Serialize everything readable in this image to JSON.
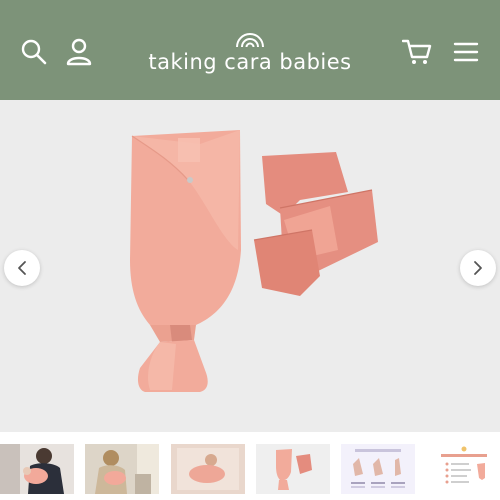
{
  "brand": {
    "name": "taking cara babies",
    "header_color": "#7d9379",
    "logo_icon": "rainbow-icon"
  },
  "header": {
    "left_icons": [
      "search-icon",
      "user-icon"
    ],
    "right_icons": [
      "cart-icon",
      "menu-icon"
    ]
  },
  "product_gallery": {
    "product_colors": {
      "swaddle": "#f0a896",
      "band": "#e08679"
    },
    "navigation_icons": [
      "chevron-left-icon",
      "chevron-right-icon"
    ],
    "thumbnail_count": 6
  }
}
